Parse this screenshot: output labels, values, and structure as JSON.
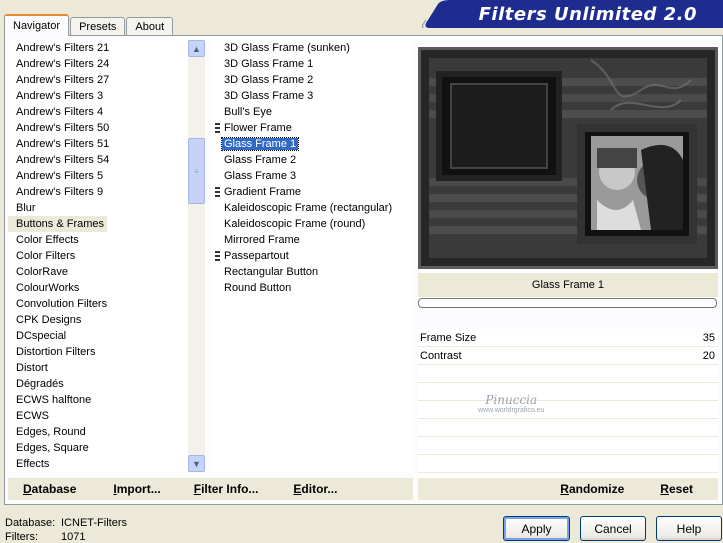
{
  "tabs": [
    {
      "label": "Navigator"
    },
    {
      "label": "Presets"
    },
    {
      "label": "About"
    }
  ],
  "app_title": "Filters Unlimited 2.0",
  "categories": [
    "Andrew's Filters 21",
    "Andrew's Filters 24",
    "Andrew's Filters 27",
    "Andrew's Filters 3",
    "Andrew's Filters 4",
    "Andrew's Filters 50",
    "Andrew's Filters 51",
    "Andrew's Filters 54",
    "Andrew's Filters 5",
    "Andrew's Filters 9",
    "Blur",
    "Buttons & Frames",
    "Color Effects",
    "Color Filters",
    "ColorRave",
    "ColourWorks",
    "Convolution Filters",
    "CPK Designs",
    "DCspecial",
    "Distortion Filters",
    "Distort",
    "Dégradés",
    "ECWS halftone",
    "ECWS",
    "Edges, Round",
    "Edges, Square",
    "Effects"
  ],
  "selected_category": "Buttons & Frames",
  "filters": [
    {
      "label": "3D Glass Frame (sunken)",
      "marker": false
    },
    {
      "label": "3D Glass Frame 1",
      "marker": false
    },
    {
      "label": "3D Glass Frame 2",
      "marker": false
    },
    {
      "label": "3D Glass Frame 3",
      "marker": false
    },
    {
      "label": "Bull's Eye",
      "marker": false
    },
    {
      "label": "Flower Frame",
      "marker": true
    },
    {
      "label": "Glass Frame 1",
      "marker": false
    },
    {
      "label": "Glass Frame 2",
      "marker": false
    },
    {
      "label": "Glass Frame 3",
      "marker": false
    },
    {
      "label": "Gradient Frame",
      "marker": true
    },
    {
      "label": "Kaleidoscopic Frame (rectangular)",
      "marker": false
    },
    {
      "label": "Kaleidoscopic Frame (round)",
      "marker": false
    },
    {
      "label": "Mirrored Frame",
      "marker": false
    },
    {
      "label": "Passepartout",
      "marker": true
    },
    {
      "label": "Rectangular Button",
      "marker": false
    },
    {
      "label": "Round Button",
      "marker": false
    }
  ],
  "selected_filter": "Glass Frame 1",
  "effect_name": "Glass Frame 1",
  "params": [
    {
      "name": "Frame Size",
      "value": "35"
    },
    {
      "name": "Contrast",
      "value": "20"
    }
  ],
  "watermark": {
    "signature": "Pinuccia",
    "url": "www.worldrgrafico.eu"
  },
  "bottom_left_buttons": [
    "Database",
    "Import...",
    "Filter Info...",
    "Editor..."
  ],
  "bottom_right_buttons": [
    "Randomize",
    "Reset"
  ],
  "status": {
    "database_label": "Database:",
    "database_value": "ICNET-Filters",
    "filters_label": "Filters:",
    "filters_value": "1071"
  },
  "dialog_buttons": {
    "apply": "Apply",
    "cancel": "Cancel",
    "help": "Help"
  },
  "colors": {
    "banner": "#1f2c8f",
    "selection": "#316ac5",
    "tab_accent": "#e68b2c",
    "dialog_bg": "#ece9d8"
  },
  "icons": {
    "scroll_up": "chevron-up-icon",
    "scroll_down": "chevron-down-icon",
    "scroll_grip": "grip-icon",
    "submenu_marker": "stack-marker-icon"
  }
}
